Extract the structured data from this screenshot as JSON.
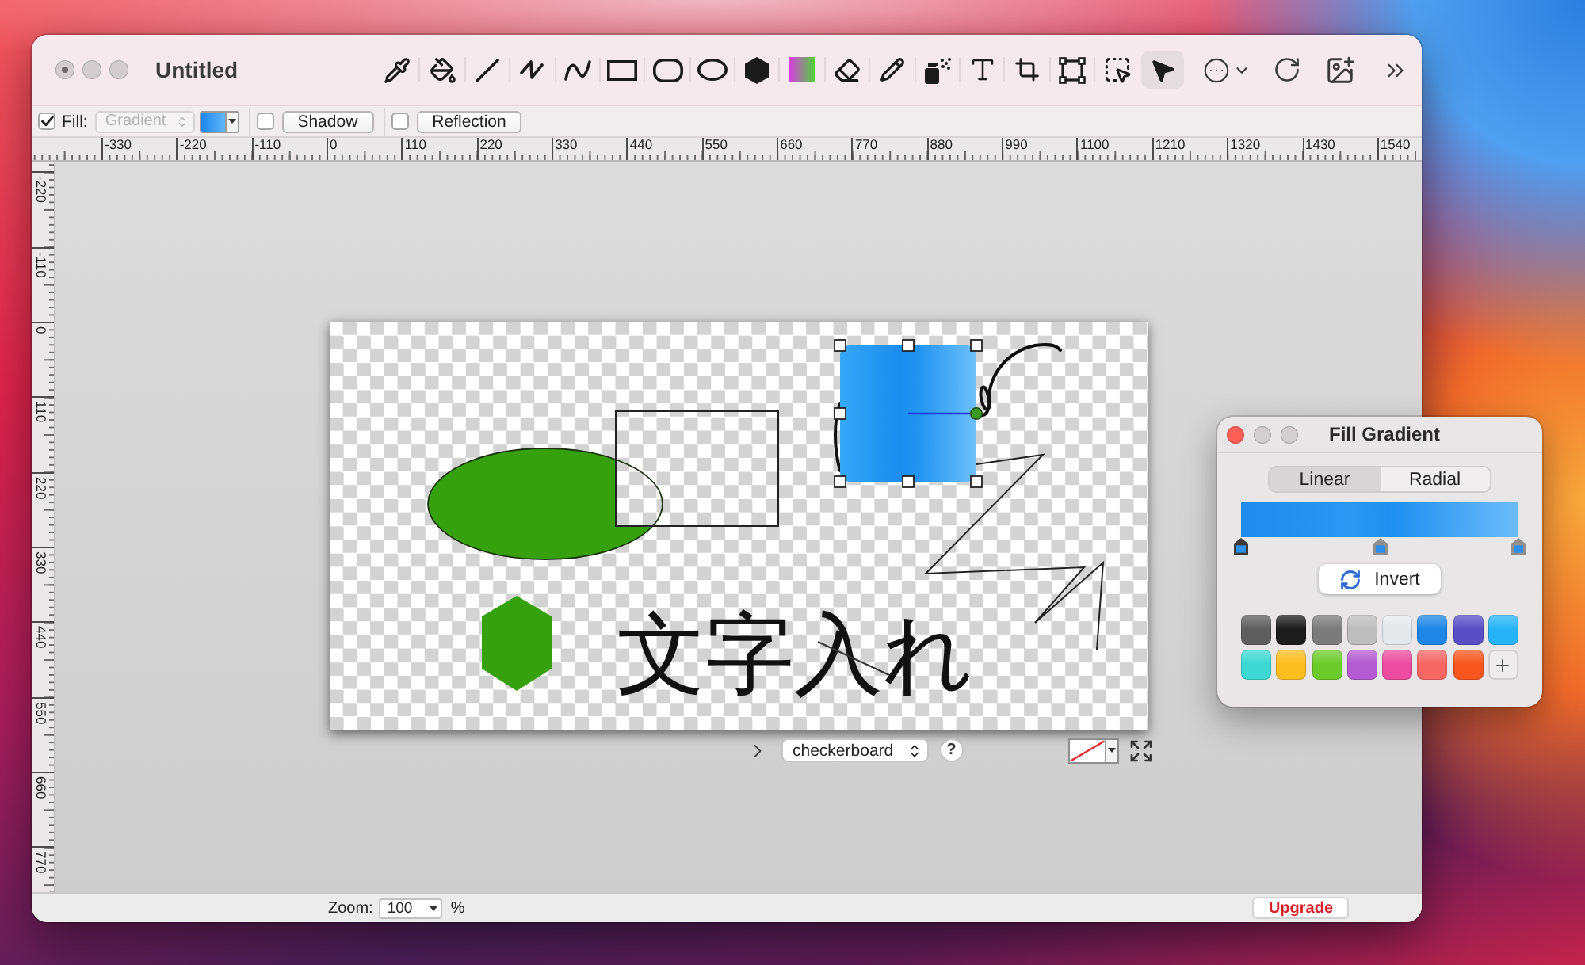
{
  "window": {
    "title": "Untitled"
  },
  "toolbar": {
    "tools": [
      {
        "kind": "eyedropper",
        "selected": false
      },
      {
        "kind": "bucket",
        "selected": false
      },
      {
        "kind": "line",
        "selected": false
      },
      {
        "kind": "polyline",
        "selected": false
      },
      {
        "kind": "curve",
        "selected": false
      },
      {
        "kind": "rectangle",
        "selected": false
      },
      {
        "kind": "roundrect",
        "selected": false
      },
      {
        "kind": "ellipse",
        "selected": false
      },
      {
        "kind": "polygon",
        "selected": false
      },
      {
        "kind": "gradient",
        "selected": false
      },
      {
        "kind": "eraser",
        "selected": false
      },
      {
        "kind": "pencil",
        "selected": false
      },
      {
        "kind": "spray",
        "selected": false
      },
      {
        "kind": "text",
        "selected": false
      },
      {
        "kind": "crop",
        "selected": false
      },
      {
        "kind": "transform",
        "selected": false
      },
      {
        "kind": "select",
        "selected": false
      },
      {
        "kind": "pointer",
        "selected": true
      }
    ],
    "actions": [
      {
        "kind": "more"
      },
      {
        "kind": "rotate"
      },
      {
        "kind": "image"
      },
      {
        "kind": "overflow"
      }
    ]
  },
  "options": {
    "fill": {
      "label": "Fill:",
      "checked": true,
      "popup": {
        "value": "Gradient",
        "disabled": true
      }
    },
    "shadow": {
      "label": "Shadow",
      "checked": false
    },
    "reflection": {
      "label": "Reflection",
      "checked": false
    }
  },
  "rulers": {
    "horizontal": [
      "-330",
      "-220",
      "-110",
      "0",
      "110",
      "220",
      "330",
      "440",
      "550",
      "660",
      "770",
      "880",
      "990",
      "1100",
      "1210",
      "1320",
      "1430",
      "1540"
    ],
    "vertical": [
      "-220",
      "-110",
      "0",
      "110",
      "220",
      "330",
      "440",
      "550",
      "660",
      "770"
    ]
  },
  "document": {
    "shapes": [
      {
        "kind": "freehand",
        "selected": false
      },
      {
        "kind": "ellipse",
        "selected": false
      },
      {
        "kind": "rectangle",
        "selected": false
      },
      {
        "kind": "zigzag",
        "selected": false
      },
      {
        "kind": "square",
        "selected": true
      },
      {
        "kind": "hexagon",
        "selected": false
      },
      {
        "kind": "line",
        "selected": false
      }
    ],
    "text": "文字入れ"
  },
  "document_bar": {
    "background": "checkerboard",
    "help": "?"
  },
  "status_bar": {
    "zoom_label": "Zoom:",
    "zoom": "100",
    "unit": "%",
    "upgrade": "Upgrade"
  },
  "gradient_panel": {
    "title": "Fill Gradient",
    "modes": [
      {
        "label": "Linear",
        "selected": true
      },
      {
        "label": "Radial",
        "selected": false
      }
    ],
    "stops": [
      {
        "selected": true
      },
      {
        "selected": false
      },
      {
        "selected": false
      }
    ],
    "invert": "Invert",
    "presets": [
      {
        "color": "#5e5e5e"
      },
      {
        "color": "#1c1c1c"
      },
      {
        "color": "#7b7b7b"
      },
      {
        "color": "#bdbdbd"
      },
      {
        "color": "#e6e9ec"
      },
      {
        "color": "#1d86e6"
      },
      {
        "color": "#5a4ec4"
      },
      {
        "color": "#27b4f6"
      },
      {
        "color": "#3dd8d2"
      },
      {
        "color": "#fcbd1e"
      },
      {
        "color": "#6ccb2b"
      },
      {
        "color": "#b35bd0"
      },
      {
        "color": "#ec4c9f"
      },
      {
        "color": "#f46763"
      },
      {
        "color": "#f7561f"
      }
    ]
  }
}
